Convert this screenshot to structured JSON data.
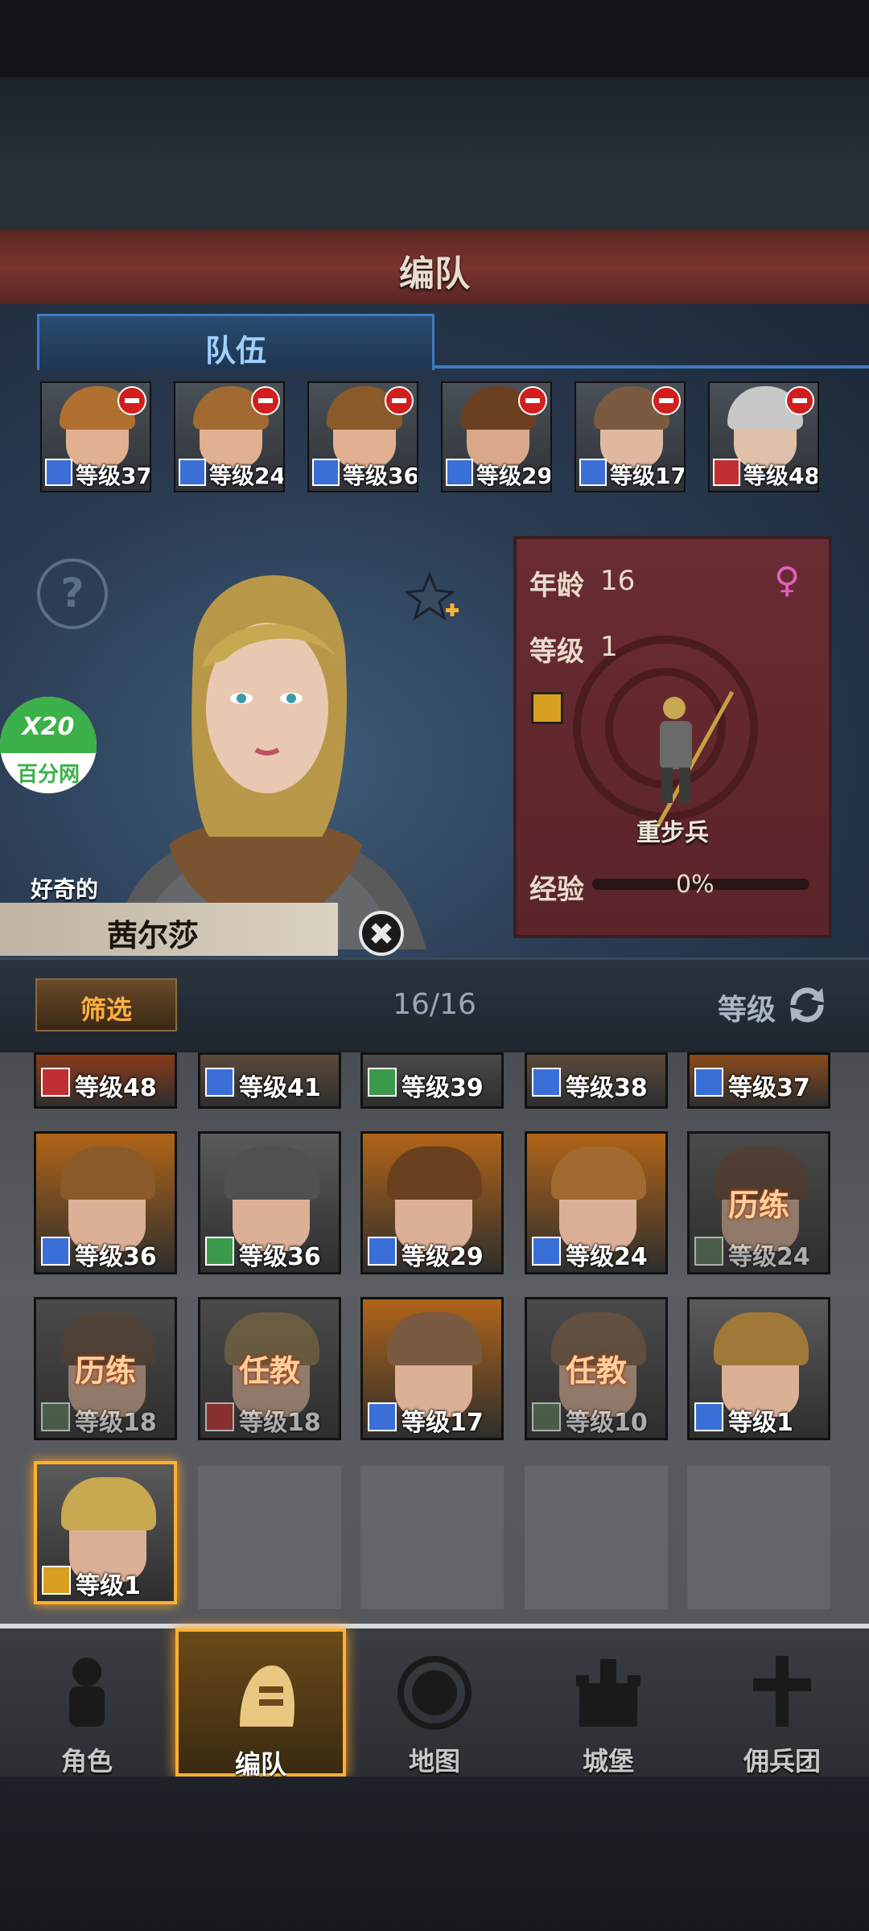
{
  "header": {
    "title": "编队"
  },
  "tabs": [
    {
      "label": "队伍",
      "active": true
    }
  ],
  "team": [
    {
      "level_text": "等级37",
      "class_color": "#3a6fd8",
      "hair": "#b07030",
      "skin": "#e0b090"
    },
    {
      "level_text": "等级24",
      "class_color": "#3a6fd8",
      "hair": "#a06a30",
      "skin": "#e0b090"
    },
    {
      "level_text": "等级36",
      "class_color": "#3a6fd8",
      "hair": "#8a5a28",
      "skin": "#e0b090"
    },
    {
      "level_text": "等级29",
      "class_color": "#3a6fd8",
      "hair": "#6a4020",
      "skin": "#d8a888"
    },
    {
      "level_text": "等级17",
      "class_color": "#3a6fd8",
      "hair": "#7a5a40",
      "skin": "#e0b8a0"
    },
    {
      "level_text": "等级48",
      "class_color": "#c03030",
      "hair": "#c8c8c8",
      "skin": "#e0c0a8"
    }
  ],
  "hero": {
    "trait": "好奇的",
    "name": "茜尔莎",
    "age_label": "年龄",
    "age_value": "16",
    "level_label": "等级",
    "level_value": "1",
    "gender_icon": "♀",
    "class_name": "重步兵",
    "exp_label": "经验",
    "exp_value": "0%",
    "exp_fraction": 0.0
  },
  "watermark": {
    "line1": "X20",
    "line2": "百分网"
  },
  "filter": {
    "label": "筛选",
    "count": "16/16",
    "sort_label": "等级"
  },
  "roster": [
    {
      "level_text": "等级48",
      "class_color": "#c03030",
      "bg": "#8a3a1a",
      "hair": "#c8c8c8",
      "tag": ""
    },
    {
      "level_text": "等级41",
      "class_color": "#3a6fd8",
      "bg": "#5a4a3a",
      "hair": "#a08860",
      "tag": ""
    },
    {
      "level_text": "等级39",
      "class_color": "#3a9a4a",
      "bg": "#4a4a4a",
      "hair": "#605040",
      "tag": ""
    },
    {
      "level_text": "等级38",
      "class_color": "#3a6fd8",
      "bg": "#5a4a3a",
      "hair": "#806040",
      "tag": ""
    },
    {
      "level_text": "等级37",
      "class_color": "#3a6fd8",
      "bg": "#8a4a1a",
      "hair": "#b07030",
      "tag": ""
    },
    {
      "level_text": "等级36",
      "class_color": "#3a6fd8",
      "bg": "#b06418",
      "hair": "#8a5a28",
      "tag": ""
    },
    {
      "level_text": "等级36",
      "class_color": "#3a9a4a",
      "bg": "#5a5a5a",
      "hair": "#505050",
      "tag": ""
    },
    {
      "level_text": "等级29",
      "class_color": "#3a6fd8",
      "bg": "#b06418",
      "hair": "#6a4020",
      "tag": ""
    },
    {
      "level_text": "等级24",
      "class_color": "#3a6fd8",
      "bg": "#b06418",
      "hair": "#a06a30",
      "tag": ""
    },
    {
      "level_text": "等级24",
      "class_color": "#5a7a5a",
      "bg": "#4a4a4a",
      "hair": "#5a3a28",
      "tag": "历练"
    },
    {
      "level_text": "等级18",
      "class_color": "#5a7a5a",
      "bg": "#4a4a4a",
      "hair": "#5a4030",
      "tag": "历练"
    },
    {
      "level_text": "等级18",
      "class_color": "#c03030",
      "bg": "#4a4a4a",
      "hair": "#8a7040",
      "tag": "任教"
    },
    {
      "level_text": "等级17",
      "class_color": "#3a6fd8",
      "bg": "#b06418",
      "hair": "#7a5a40",
      "tag": ""
    },
    {
      "level_text": "等级10",
      "class_color": "#5a7a5a",
      "bg": "#4a4a4a",
      "hair": "#7a5a40",
      "tag": "任教"
    },
    {
      "level_text": "等级1",
      "class_color": "#3a6fd8",
      "bg": "#5a5a5a",
      "hair": "#a07838",
      "tag": ""
    },
    {
      "level_text": "等级1",
      "class_color": "#d8a020",
      "bg": "#5a5a5a",
      "hair": "#c8a850",
      "tag": "",
      "selected": true
    }
  ],
  "nav": [
    {
      "label": "角色",
      "icon": "knight-icon",
      "active": false
    },
    {
      "label": "编队",
      "icon": "helmet-icon",
      "active": true
    },
    {
      "label": "地图",
      "icon": "compass-map-icon",
      "active": false
    },
    {
      "label": "城堡",
      "icon": "castle-icon",
      "active": false
    },
    {
      "label": "佣兵团",
      "icon": "mercenary-icon",
      "active": false
    }
  ]
}
